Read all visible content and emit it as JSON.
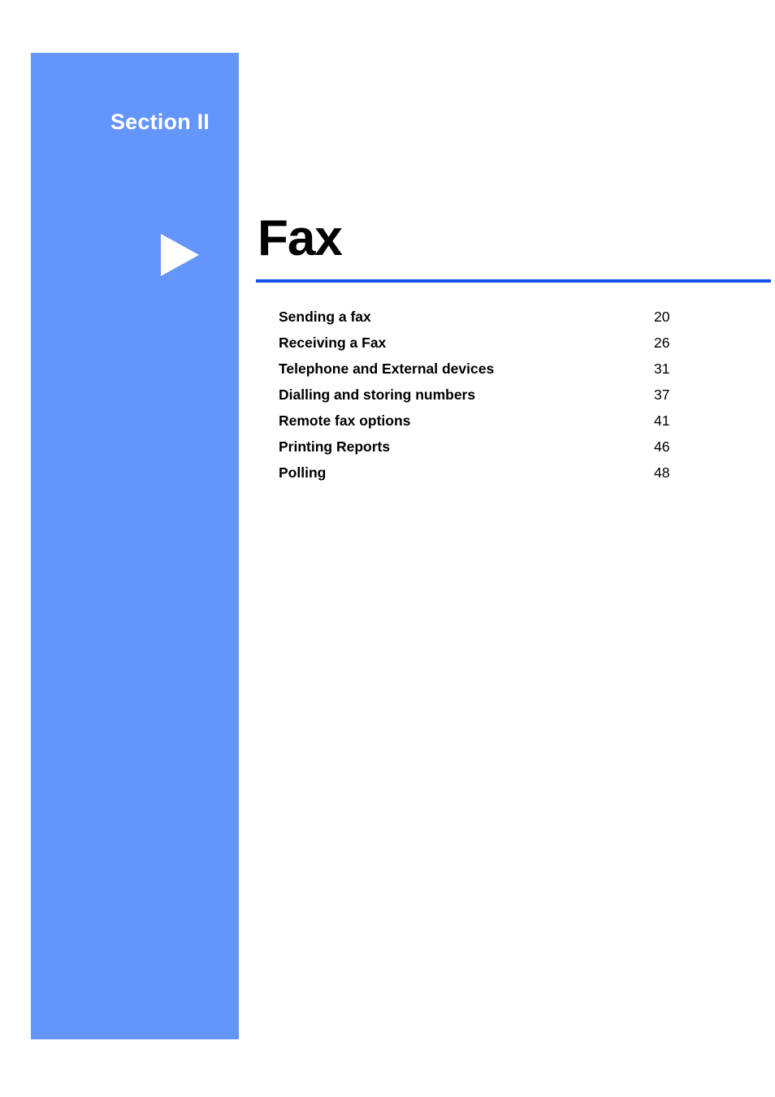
{
  "section": {
    "label": "Section II",
    "arrow_icon": "triangle-right-icon",
    "band_color": "#6495fa",
    "label_color": "#ffffff"
  },
  "title": {
    "text": "Fax",
    "rule_color": "#1254ec"
  },
  "toc": {
    "entries": [
      {
        "title": "Sending a fax",
        "page": "20"
      },
      {
        "title": "Receiving a Fax",
        "page": "26"
      },
      {
        "title": "Telephone and External devices",
        "page": "31"
      },
      {
        "title": "Dialling and storing numbers",
        "page": "37"
      },
      {
        "title": "Remote fax options",
        "page": "41"
      },
      {
        "title": "Printing Reports",
        "page": "46"
      },
      {
        "title": "Polling",
        "page": "48"
      }
    ]
  }
}
